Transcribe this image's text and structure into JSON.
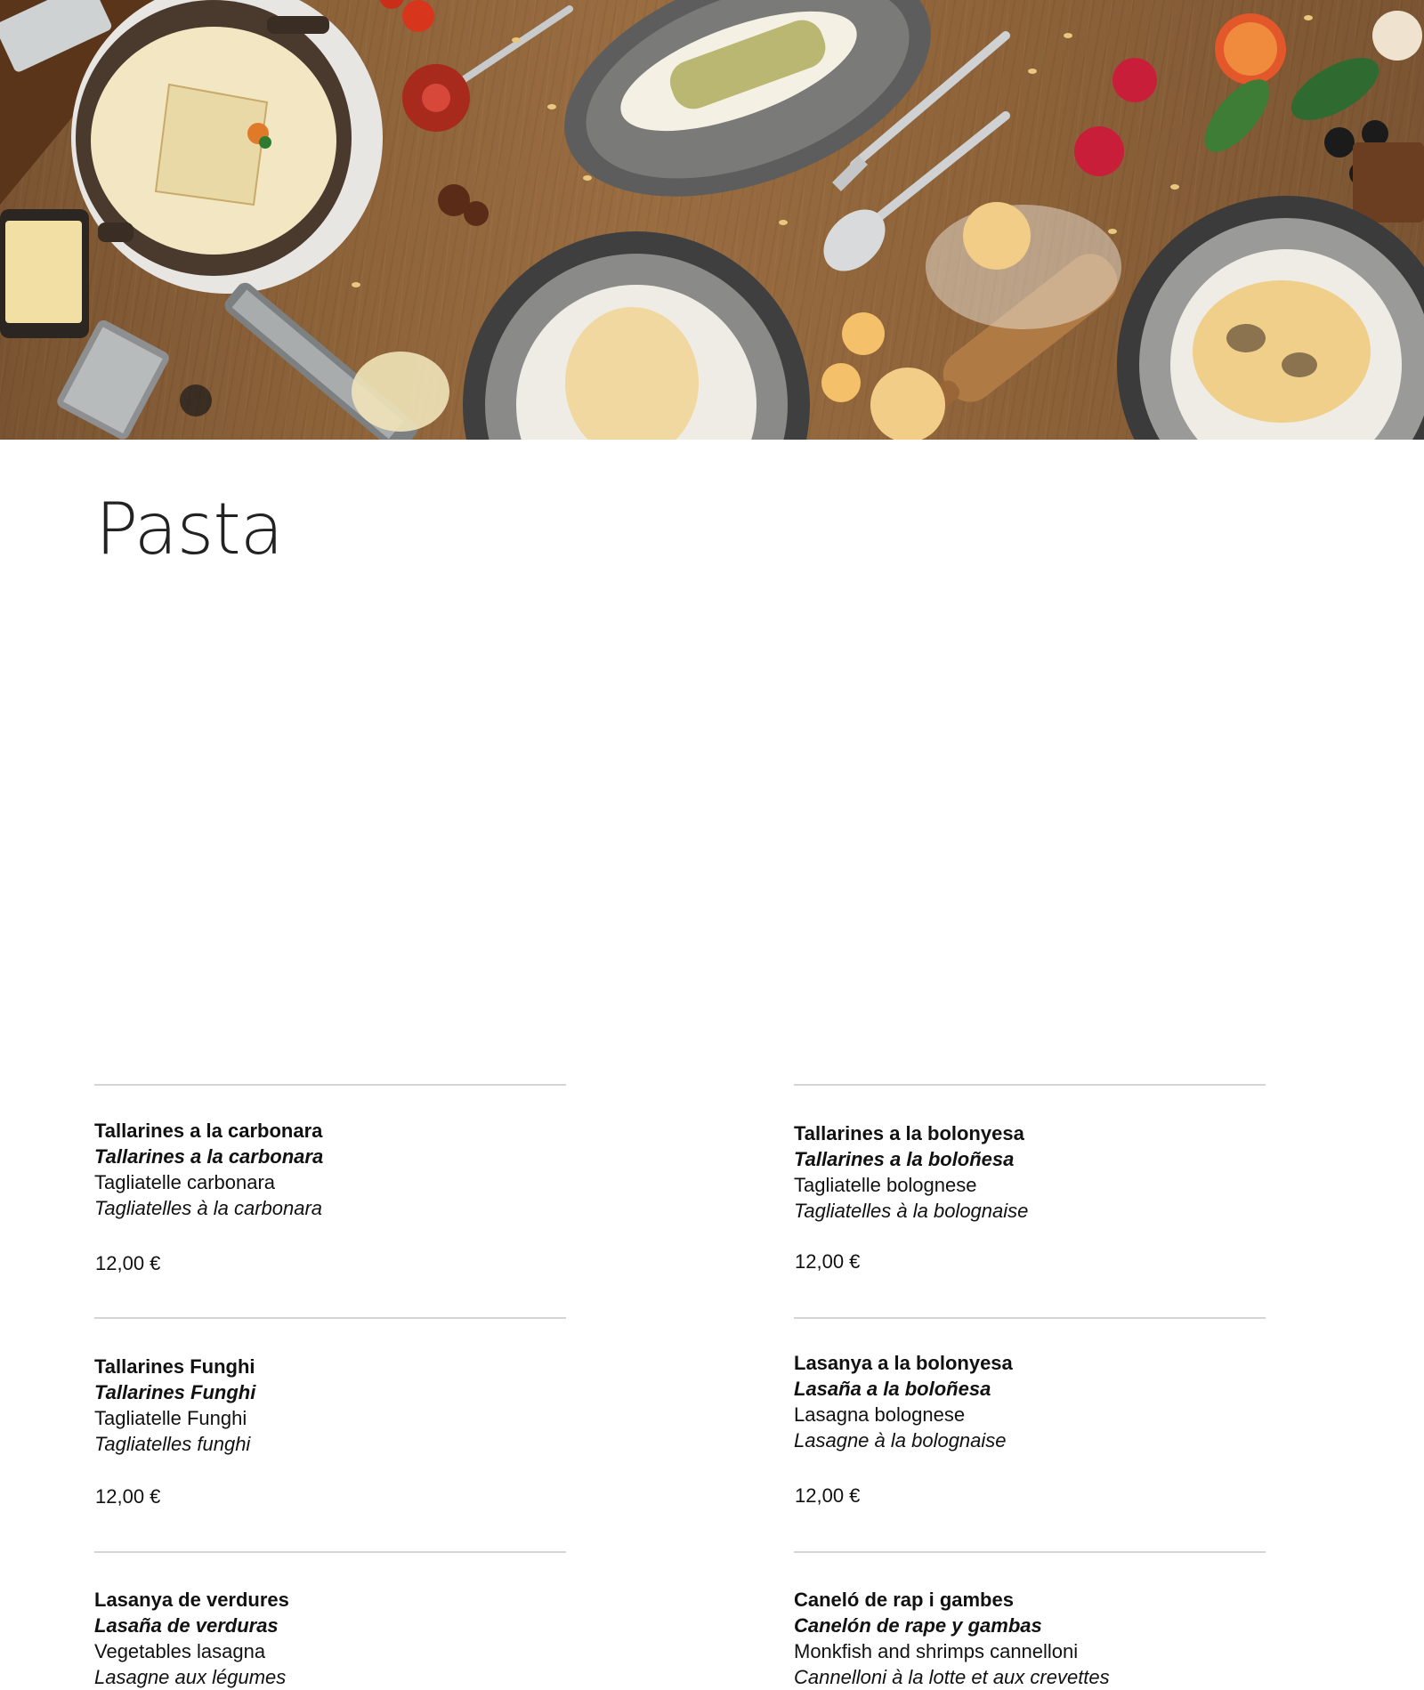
{
  "section": {
    "title": "Pasta"
  },
  "items": [
    {
      "name_ca": "Tallarines a la carbonara",
      "name_es": "Tallarines a la carbonara",
      "name_en": "Tagliatelle carbonara",
      "name_fr": "Tagliatelles à la carbonara",
      "price": "12,00 €"
    },
    {
      "name_ca": "Tallarines a la bolonyesa",
      "name_es": "Tallarines a la boloñesa",
      "name_en": "Tagliatelle bolognese",
      "name_fr": "Tagliatelles à la bolognaise",
      "price": "12,00 €"
    },
    {
      "name_ca": "Tallarines Funghi",
      "name_es": "Tallarines Funghi",
      "name_en": "Tagliatelle Funghi",
      "name_fr": "Tagliatelles funghi",
      "price": "12,00 €"
    },
    {
      "name_ca": "Lasanya a la bolonyesa",
      "name_es": "Lasaña a la boloñesa",
      "name_en": "Lasagna bolognese",
      "name_fr": "Lasagne à la bolognaise",
      "price": "12,00 €"
    },
    {
      "name_ca": "Lasanya de verdures",
      "name_es": "Lasaña de verduras",
      "name_en": "Vegetables lasagna",
      "name_fr": "Lasagne aux légumes"
    },
    {
      "name_ca": "Caneló de rap i gambes",
      "name_es": "Canelón de rape y gambas",
      "name_en": "Monkfish and shrimps cannelloni",
      "name_fr": "Cannelloni à la lotte et aux crevettes"
    }
  ]
}
